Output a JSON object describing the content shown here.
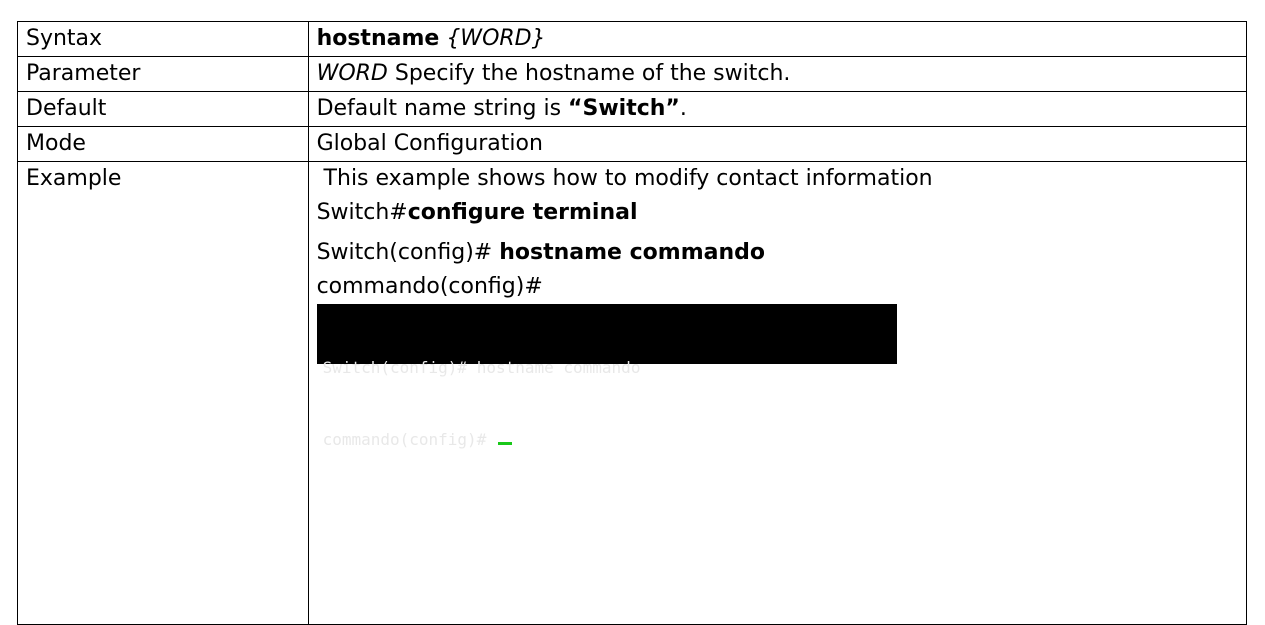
{
  "rows": [
    {
      "label": "Syntax",
      "cmd": "hostname",
      "arg": "{WORD}"
    },
    {
      "label": "Parameter",
      "arg": "WORD",
      "text": "Specify the hostname of the switch."
    },
    {
      "label": "Default",
      "pre": "Default name string is ",
      "value": "“Switch”",
      "post": "."
    },
    {
      "label": "Mode",
      "text": "Global Configuration"
    },
    {
      "label": "Example",
      "intro": " This example shows how to modify contact information",
      "line1_prompt": "Switch#",
      "line1_cmd": "configure terminal",
      "line2_prompt": "Switch(config)# ",
      "line2_cmd": "hostname commando",
      "line3": "commando(config)#",
      "terminal": {
        "line1": "Switch(config)# hostname commando",
        "line2": "commando(config)# ",
        "cursor_color": "#19c819"
      }
    }
  ]
}
